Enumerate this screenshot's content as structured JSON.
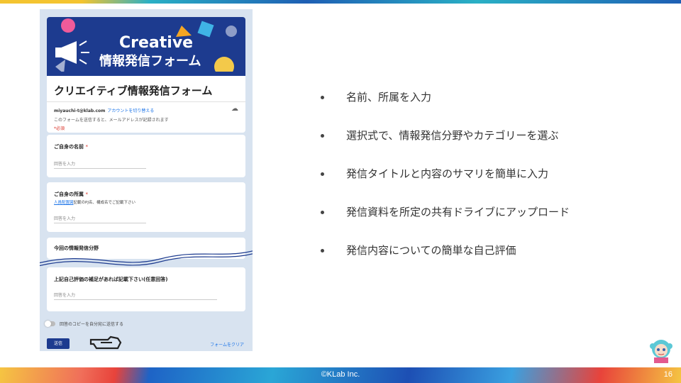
{
  "form": {
    "banner_line1": "Creative",
    "banner_line2": "情報発信フォーム",
    "title": "クリエイティブ情報発信フォーム",
    "email": "miyauchi-t@klab.com",
    "switch_account": "アカウントを切り替える",
    "email_note": "このフォームを送信すると、メールアドレスが記録されます",
    "required_note": "*必須",
    "q1_label": "ご自身の名前",
    "q1_placeholder": "回答を入力",
    "q2_label": "ご自身の所属",
    "q2_link": "人員配置図",
    "q2_sub": "記載のPJ名、構成名でご記載下さい",
    "q2_placeholder": "回答を入力",
    "q3_label": "今回の情報発信分野",
    "q4_label": "上記自己評価の補足があれば記載下さい(任意回答)",
    "q4_placeholder": "回答を入力",
    "copy_label": "回答のコピーを自分宛に送信する",
    "submit_label": "送信",
    "clear_label": "フォームをクリア"
  },
  "bullets": [
    "名前、所属を入力",
    "選択式で、情報発信分野やカテゴリーを選ぶ",
    "発信タイトルと内容のサマリを簡単に入力",
    "発信資料を所定の共有ドライブにアップロード",
    "発信内容についての簡単な自己評価"
  ],
  "footer": {
    "copyright": "©KLab Inc.",
    "page_number": "16"
  },
  "colors": {
    "brand_blue": "#1d3b8f",
    "link_blue": "#1a73e8",
    "required_red": "#d93025"
  },
  "icons": [
    "megaphone-icon",
    "cloud-icon",
    "pointing-hand-icon",
    "mascot-icon"
  ]
}
